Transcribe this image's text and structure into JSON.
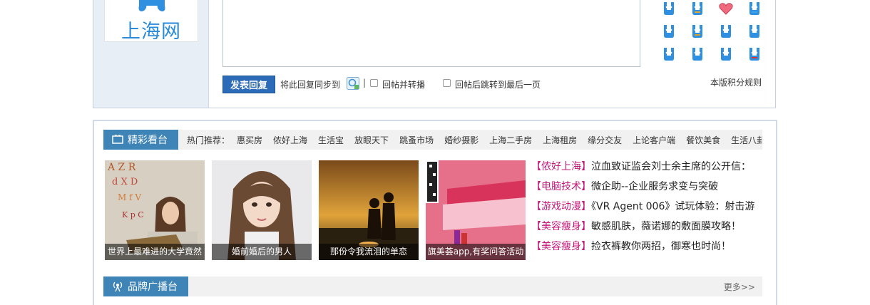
{
  "logo": {
    "text": "上海网"
  },
  "reply": {
    "textarea_value": "",
    "submit_label": "发表回复",
    "sync_label": "将此回复同步到",
    "separator": "|",
    "repost_label": "回帖并转播",
    "jump_label": "回帖后跳转到最后一页",
    "rules_link": "本版积分规则"
  },
  "emoji": [
    "mascot-icon",
    "mascot-icon",
    "heart-icon",
    "mascot-icon",
    "mascot-icon",
    "mascot-icon",
    "mascot-icon",
    "mascot-icon",
    "mascot-icon",
    "mascot-icon",
    "mascot-icon",
    "mascot-icon"
  ],
  "featured": {
    "title": "精彩看台",
    "hot_label": "热门推荐：",
    "hot_links": [
      "惠买房",
      "侬好上海",
      "生活宝",
      "放眼天下",
      "跳蚤市场",
      "婚纱摄影",
      "上海二手房",
      "上海租房",
      "缘分交友",
      "上论客户端",
      "餐饮美食",
      "生活八卦"
    ],
    "thumbs": [
      {
        "caption": "世界上最难进的大学竟然"
      },
      {
        "caption": "婚前婚后的男人"
      },
      {
        "caption": "那份令我流泪的单恋"
      },
      {
        "caption": "旗美荟app,有奖问答活动"
      }
    ],
    "news": [
      {
        "category": "【侬好上海】",
        "title": "泣血致证监会刘士余主席的公开信："
      },
      {
        "category": "【电脑技术】",
        "title": "微企助--企业服务求变与突破"
      },
      {
        "category": "【游戏动漫】",
        "title": "《VR Agent 006》试玩体验：射击游"
      },
      {
        "category": "【美容瘦身】",
        "title": "敏感肌肤，薇诺娜的敷面膜攻略！"
      },
      {
        "category": "【美容瘦身】",
        "title": "捡衣裤教你两招，御寒也时尚！"
      }
    ]
  },
  "brand": {
    "title": "品牌广播台",
    "more": "更多>>"
  },
  "colors": {
    "accent": "#3f84b6",
    "button": "#2b6bb7",
    "category": "#c2187a"
  }
}
